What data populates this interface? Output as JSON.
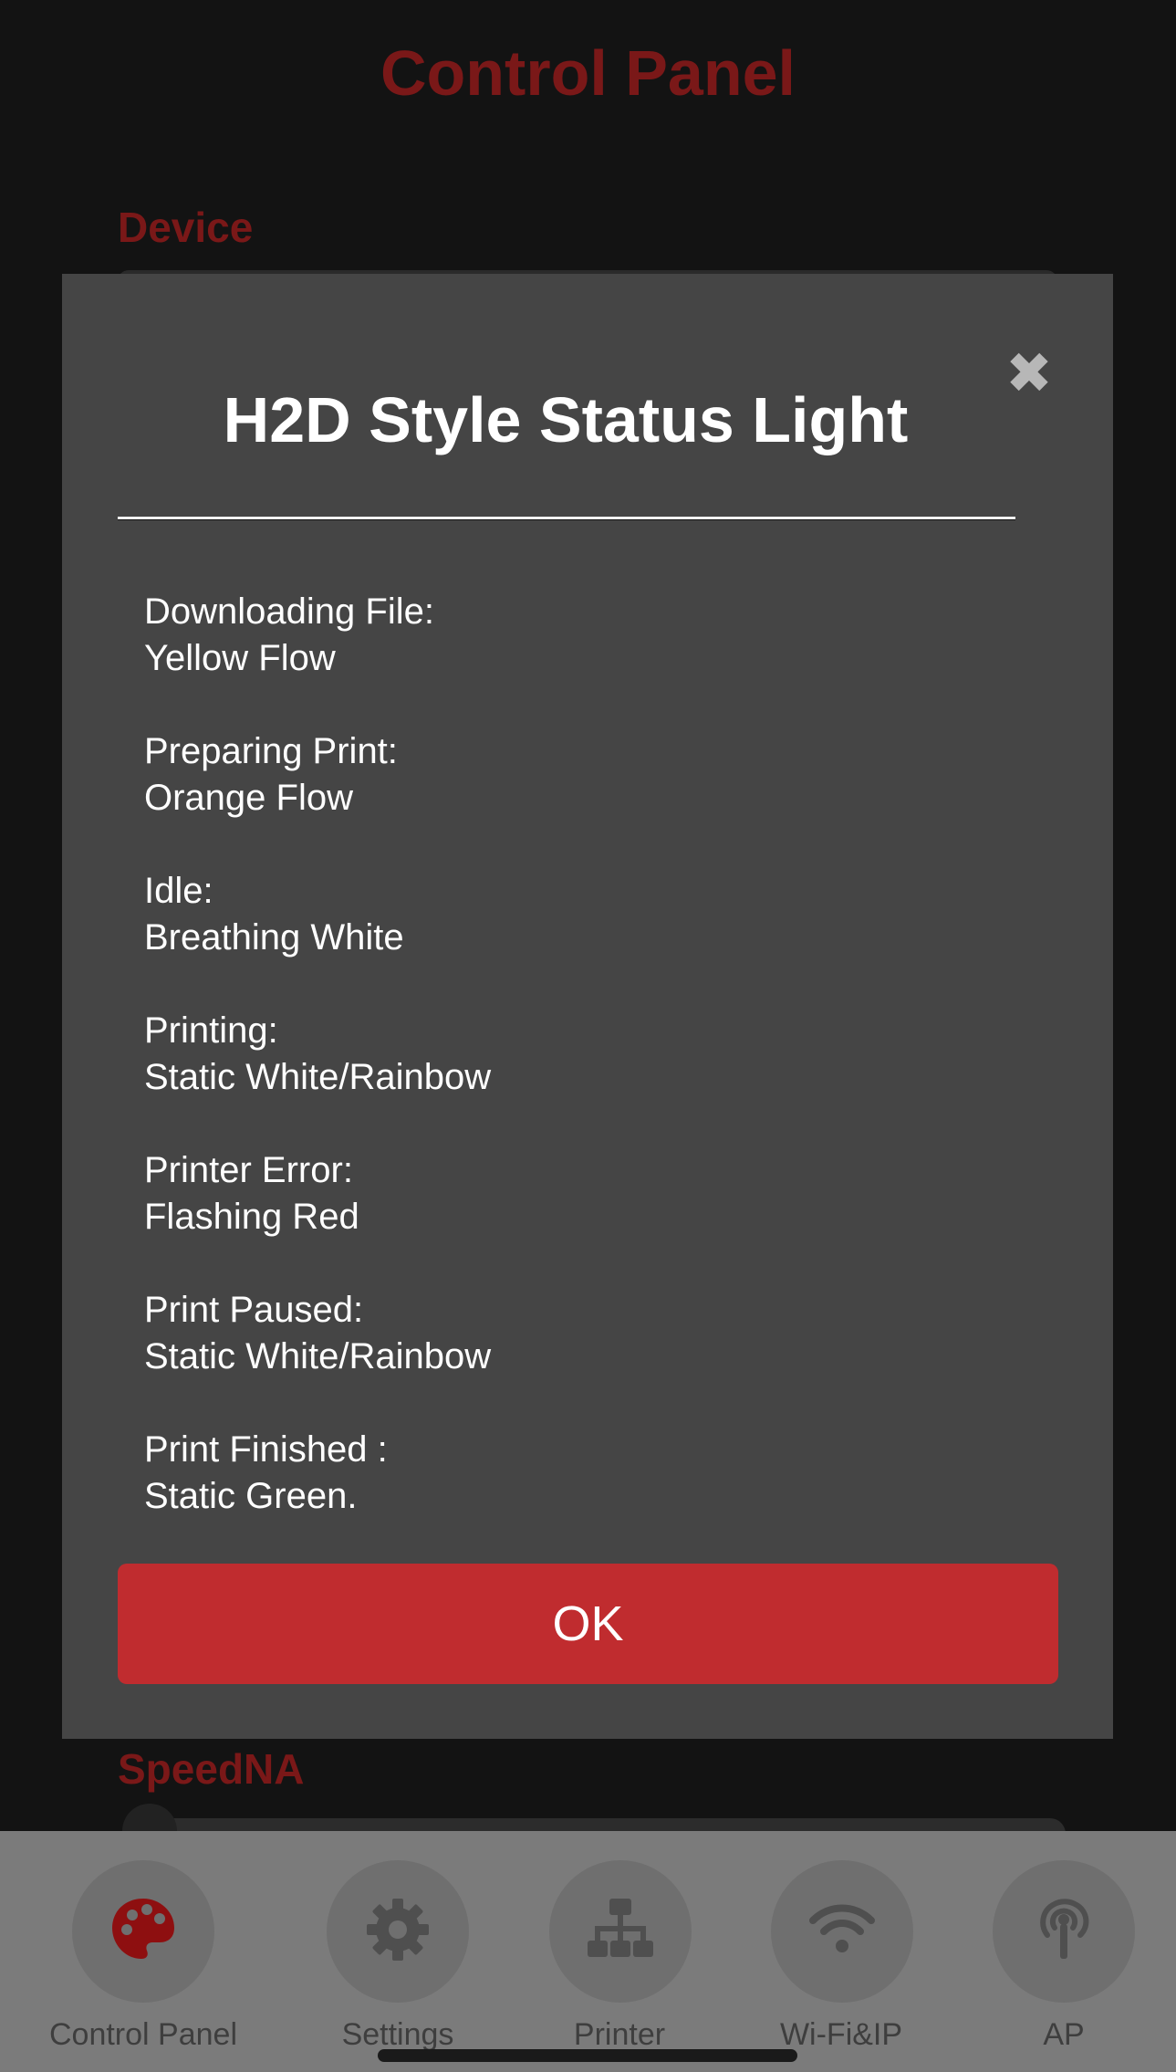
{
  "background": {
    "title": "Control Panel",
    "device_label": "Device",
    "speed_label": "SpeedNA"
  },
  "modal": {
    "title": "H2D Style Status Light",
    "close_symbol": "✖",
    "statuses": [
      {
        "label": "Downloading File:",
        "value": "Yellow Flow"
      },
      {
        "label": "Preparing Print:",
        "value": "Orange Flow"
      },
      {
        "label": "Idle:",
        "value": "Breathing White"
      },
      {
        "label": "Printing:",
        "value": "Static White/Rainbow"
      },
      {
        "label": "Printer Error:",
        "value": "Flashing Red"
      },
      {
        "label": "Print Paused:",
        "value": "Static White/Rainbow"
      },
      {
        "label": "Print Finished :",
        "value": "Static Green."
      }
    ],
    "ok_label": "OK"
  },
  "nav": {
    "items": [
      {
        "label": "Control Panel",
        "icon": "palette-icon",
        "active": true
      },
      {
        "label": "Settings",
        "icon": "gear-icon",
        "active": false
      },
      {
        "label": "Printer",
        "icon": "network-icon",
        "active": false
      },
      {
        "label": "Wi-Fi&IP",
        "icon": "wifi-icon",
        "active": false
      },
      {
        "label": "AP",
        "icon": "antenna-icon",
        "active": false
      }
    ]
  },
  "colors": {
    "accent": "#c02c2f",
    "active_icon": "#8e0f10",
    "inactive_icon": "#4f4f4f"
  }
}
